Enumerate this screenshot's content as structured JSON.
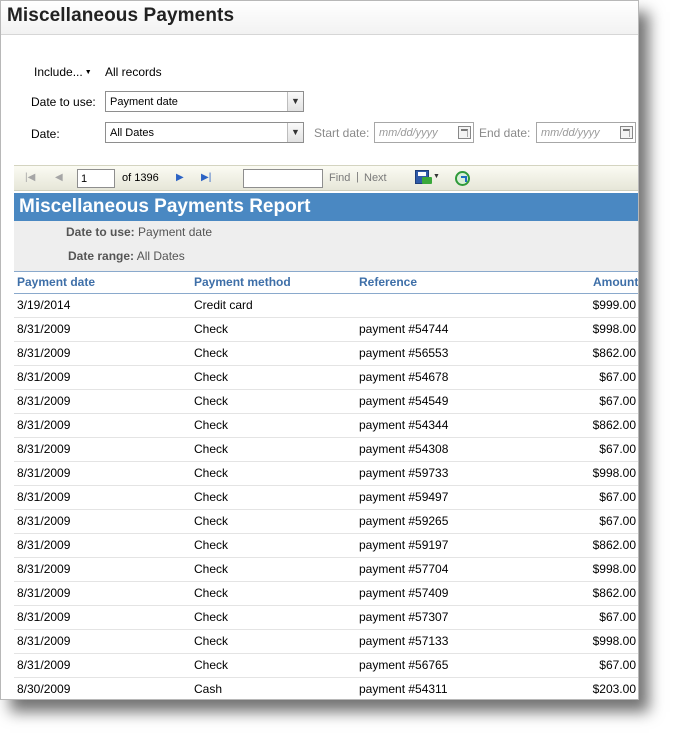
{
  "page": {
    "title": "Miscellaneous Payments"
  },
  "filters": {
    "include_label": "Include...",
    "include_value": "All records",
    "date_to_use_label": "Date to use:",
    "date_to_use_value": "Payment date",
    "date_label": "Date:",
    "date_value": "All Dates",
    "start_date_label": "Start date:",
    "start_date_placeholder": "mm/dd/yyyy",
    "end_date_label": "End date:",
    "end_date_placeholder": "mm/dd/yyyy"
  },
  "toolbar": {
    "current_page": "1",
    "page_count_text": "of 1396",
    "find_label": "Find",
    "separator": "|",
    "next_label": "Next"
  },
  "report": {
    "title": "Miscellaneous Payments Report",
    "date_to_use_label": "Date to use:",
    "date_to_use_value": "Payment date",
    "date_range_label": "Date range:",
    "date_range_value": "All Dates",
    "columns": [
      "Payment date",
      "Payment method",
      "Reference",
      "Amount"
    ],
    "rows": [
      [
        "3/19/2014",
        "Credit card",
        "",
        "$999.00"
      ],
      [
        "8/31/2009",
        "Check",
        "payment #54744",
        "$998.00"
      ],
      [
        "8/31/2009",
        "Check",
        "payment #56553",
        "$862.00"
      ],
      [
        "8/31/2009",
        "Check",
        "payment #54678",
        "$67.00"
      ],
      [
        "8/31/2009",
        "Check",
        "payment #54549",
        "$67.00"
      ],
      [
        "8/31/2009",
        "Check",
        "payment #54344",
        "$862.00"
      ],
      [
        "8/31/2009",
        "Check",
        "payment #54308",
        "$67.00"
      ],
      [
        "8/31/2009",
        "Check",
        "payment #59733",
        "$998.00"
      ],
      [
        "8/31/2009",
        "Check",
        "payment #59497",
        "$67.00"
      ],
      [
        "8/31/2009",
        "Check",
        "payment #59265",
        "$67.00"
      ],
      [
        "8/31/2009",
        "Check",
        "payment #59197",
        "$862.00"
      ],
      [
        "8/31/2009",
        "Check",
        "payment #57704",
        "$998.00"
      ],
      [
        "8/31/2009",
        "Check",
        "payment #57409",
        "$862.00"
      ],
      [
        "8/31/2009",
        "Check",
        "payment #57307",
        "$67.00"
      ],
      [
        "8/31/2009",
        "Check",
        "payment #57133",
        "$998.00"
      ],
      [
        "8/31/2009",
        "Check",
        "payment #56765",
        "$67.00"
      ],
      [
        "8/30/2009",
        "Cash",
        "payment #54311",
        "$203.00"
      ]
    ]
  },
  "colors": {
    "report_header_bg": "#4a88c2",
    "column_header_text": "#3e6fa8"
  },
  "icons": [
    "first-page-icon",
    "previous-page-icon",
    "next-page-icon",
    "last-page-icon",
    "save-export-icon",
    "refresh-icon",
    "calendar-icon",
    "dropdown-arrow-icon"
  ]
}
